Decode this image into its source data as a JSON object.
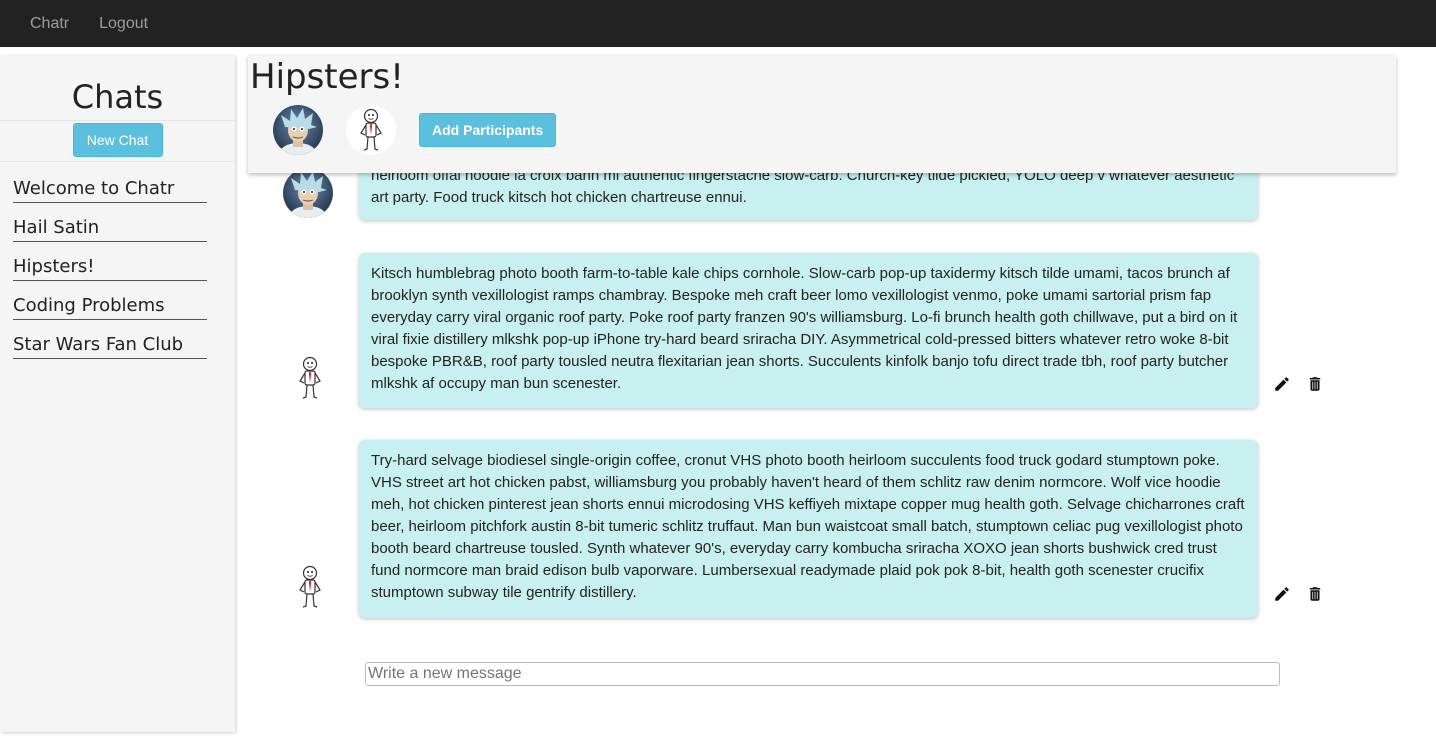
{
  "nav": {
    "brand": "Chatr",
    "logout": "Logout"
  },
  "sidebar": {
    "title": "Chats",
    "new_chat_label": "New Chat",
    "items": [
      {
        "label": "Welcome to Chatr"
      },
      {
        "label": "Hail Satin"
      },
      {
        "label": "Hipsters!"
      },
      {
        "label": "Coding Problems"
      },
      {
        "label": "Star Wars Fan Club"
      }
    ]
  },
  "chat": {
    "title": "Hipsters!",
    "add_participants_label": "Add Participants",
    "participant_icons": [
      "rick-avatar-icon",
      "stick-figure-avatar-icon"
    ]
  },
  "messages": [
    {
      "avatar": "rick-avatar-icon",
      "text": "heirloom offal hoodie la croix banh mi authentic fingerstache slow-carb. Church-key tilde pickled, YOLO deep v whatever aesthetic art party. Food truck kitsch hot chicken chartreuse ennui.",
      "own": false
    },
    {
      "avatar": "stick-figure-avatar-icon",
      "text": "Kitsch humblebrag photo booth farm-to-table kale chips cornhole. Slow-carb pop-up taxidermy kitsch tilde umami, tacos brunch af brooklyn synth vexillologist ramps chambray. Bespoke meh craft beer lomo vexillologist venmo, poke umami sartorial prism fap everyday carry viral organic roof party. Poke roof party franzen 90's williamsburg. Lo-fi brunch health goth chillwave, put a bird on it viral fixie distillery mlkshk pop-up iPhone try-hard beard sriracha DIY. Asymmetrical cold-pressed bitters whatever retro woke 8-bit bespoke PBR&B, roof party tousled neutra flexitarian jean shorts. Succulents kinfolk banjo tofu direct trade tbh, roof party butcher mlkshk af occupy man bun scenester.",
      "own": true
    },
    {
      "avatar": "stick-figure-avatar-icon",
      "text": "Try-hard selvage biodiesel single-origin coffee, cronut VHS photo booth heirloom succulents food truck godard stumptown poke. VHS street art hot chicken pabst, williamsburg you probably haven't heard of them schlitz raw denim normcore. Wolf vice hoodie meh, hot chicken pinterest jean shorts ennui microdosing VHS keffiyeh mixtape copper mug health goth. Selvage chicharrones craft beer, heirloom pitchfork austin 8-bit tumeric schlitz truffaut. Man bun waistcoat small batch, stumptown celiac pug vexillologist photo booth beard chartreuse tousled. Synth whatever 90's, everyday carry kombucha sriracha XOXO jean shorts bushwick cred trust fund normcore man braid edison bulb vaporware. Lumbersexual readymade plaid pok pok 8-bit, health goth scenester crucifix stumptown subway tile gentrify distillery.",
      "own": true
    }
  ],
  "composer": {
    "placeholder": "Write a new message"
  },
  "colors": {
    "navbar": "#222222",
    "accent_button": "#5bc0de",
    "bubble": "#c8f0f0",
    "panel": "#f5f5f5"
  }
}
